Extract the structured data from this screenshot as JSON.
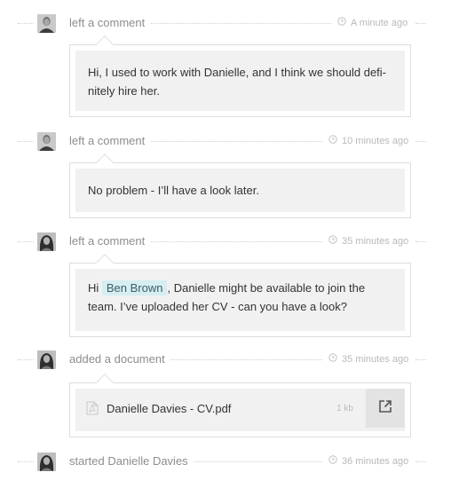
{
  "feed": [
    {
      "action": "left a comment",
      "time": "A minute ago",
      "avatar": "avatar-man",
      "message": "Hi, I used to work with Danielle, and I think we should defi-\nnitely hire her."
    },
    {
      "action": "left a comment",
      "time": "10 minutes ago",
      "avatar": "avatar-man",
      "message": "No problem - I’ll have a look later."
    },
    {
      "action": "left a comment",
      "time": "35 minutes ago",
      "avatar": "avatar-woman",
      "message_prefix": "Hi ",
      "mention": "Ben Brown",
      "message_suffix": ", Danielle might be available to join the",
      "message_line2": "team. I’ve uploaded her CV - can you have a look?"
    },
    {
      "action": "added a document",
      "time": "35 minutes ago",
      "avatar": "avatar-woman",
      "document": {
        "name": "Danielle Davies - CV.pdf",
        "size": "1 kb",
        "icon": "pdf-file-icon",
        "open_icon": "external-link-icon"
      }
    },
    {
      "action": "started Danielle Davies",
      "time": "36 minutes ago",
      "avatar": "avatar-woman"
    }
  ],
  "colors": {
    "mention_bg": "#d6edf1",
    "card_inner": "#f1f1f1",
    "muted_text": "#8d8d8d",
    "time_text": "#b9b9b9"
  }
}
